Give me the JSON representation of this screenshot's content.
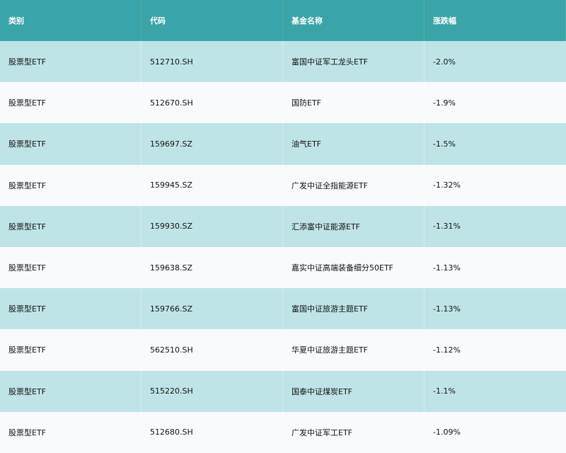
{
  "table": {
    "headers": [
      "类别",
      "代码",
      "基金名称",
      "涨跌幅"
    ],
    "rows": [
      [
        "股票型ETF",
        "512710.SH",
        "富国中证军工龙头ETF",
        "-2.0%"
      ],
      [
        "股票型ETF",
        "512670.SH",
        "国防ETF",
        "-1.9%"
      ],
      [
        "股票型ETF",
        "159697.SZ",
        "油气ETF",
        "-1.5%"
      ],
      [
        "股票型ETF",
        "159945.SZ",
        "广发中证全指能源ETF",
        "-1.32%"
      ],
      [
        "股票型ETF",
        "159930.SZ",
        "汇添富中证能源ETF",
        "-1.31%"
      ],
      [
        "股票型ETF",
        "159638.SZ",
        "嘉实中证高端装备细分50ETF",
        "-1.13%"
      ],
      [
        "股票型ETF",
        "159766.SZ",
        "富国中证旅游主题ETF",
        "-1.13%"
      ],
      [
        "股票型ETF",
        "562510.SH",
        "华夏中证旅游主题ETF",
        "-1.12%"
      ],
      [
        "股票型ETF",
        "515220.SH",
        "国泰中证煤炭ETF",
        "-1.1%"
      ],
      [
        "股票型ETF",
        "512680.SH",
        "广发中证军工ETF",
        "-1.09%"
      ]
    ]
  },
  "colors": {
    "header_bg": "#3aa4a8",
    "row_odd_bg": "#bfe4e8",
    "row_even_bg": "#f8fafd"
  }
}
